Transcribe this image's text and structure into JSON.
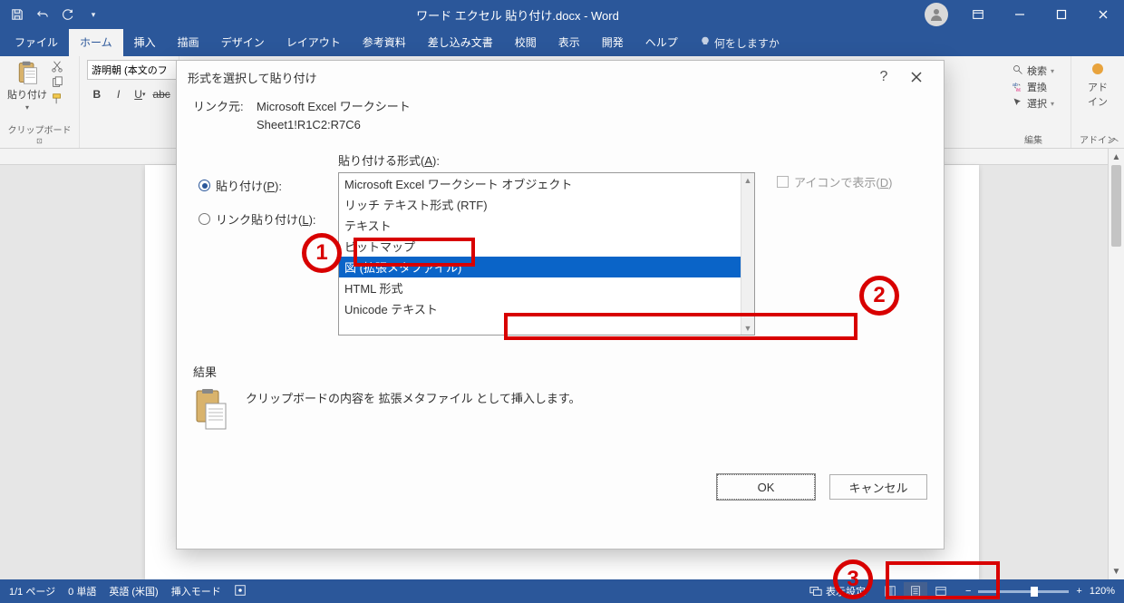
{
  "titlebar": {
    "doc_title": "ワード エクセル 貼り付け.docx  -  Word"
  },
  "tabs": {
    "file": "ファイル",
    "home": "ホーム",
    "insert": "挿入",
    "draw": "描画",
    "design": "デザイン",
    "layout": "レイアウト",
    "references": "参考資料",
    "mailings": "差し込み文書",
    "review": "校閲",
    "view": "表示",
    "developer": "開発",
    "help": "ヘルプ",
    "tell": "何をしますか"
  },
  "ribbon": {
    "paste": "貼り付け",
    "clipboard": "クリップボード",
    "font_name": "游明朝 (本文のフ",
    "editing_group": "編集",
    "find": "検索",
    "replace": "置換",
    "select": "選択",
    "addin_group": "アドイン",
    "addin": "アド\nイン"
  },
  "dialog": {
    "title": "形式を選択して貼り付け",
    "source_label": "リンク元:",
    "source_line1": "Microsoft Excel ワークシート",
    "source_line2": "Sheet1!R1C2:R7C6",
    "radio_paste": "貼り付け(P):",
    "radio_link": "リンク貼り付け(L):",
    "list_label": "貼り付ける形式(A):",
    "items": [
      "Microsoft Excel ワークシート オブジェクト",
      "リッチ テキスト形式 (RTF)",
      "テキスト",
      "ビットマップ",
      "図 (拡張メタファイル)",
      "HTML 形式",
      "Unicode テキスト"
    ],
    "selected_index": 4,
    "icon_label": "アイコンで表示(D)",
    "result_label": "結果",
    "result_text": "クリップボードの内容を 拡張メタファイル として挿入します。",
    "ok": "OK",
    "cancel": "キャンセル"
  },
  "callouts": {
    "c1": "1",
    "c2": "2",
    "c3": "3"
  },
  "status": {
    "page": "1/1 ページ",
    "words": "0 単語",
    "lang": "英語 (米国)",
    "insert": "挿入モード",
    "display": "表示設定",
    "zoom": "120%"
  }
}
